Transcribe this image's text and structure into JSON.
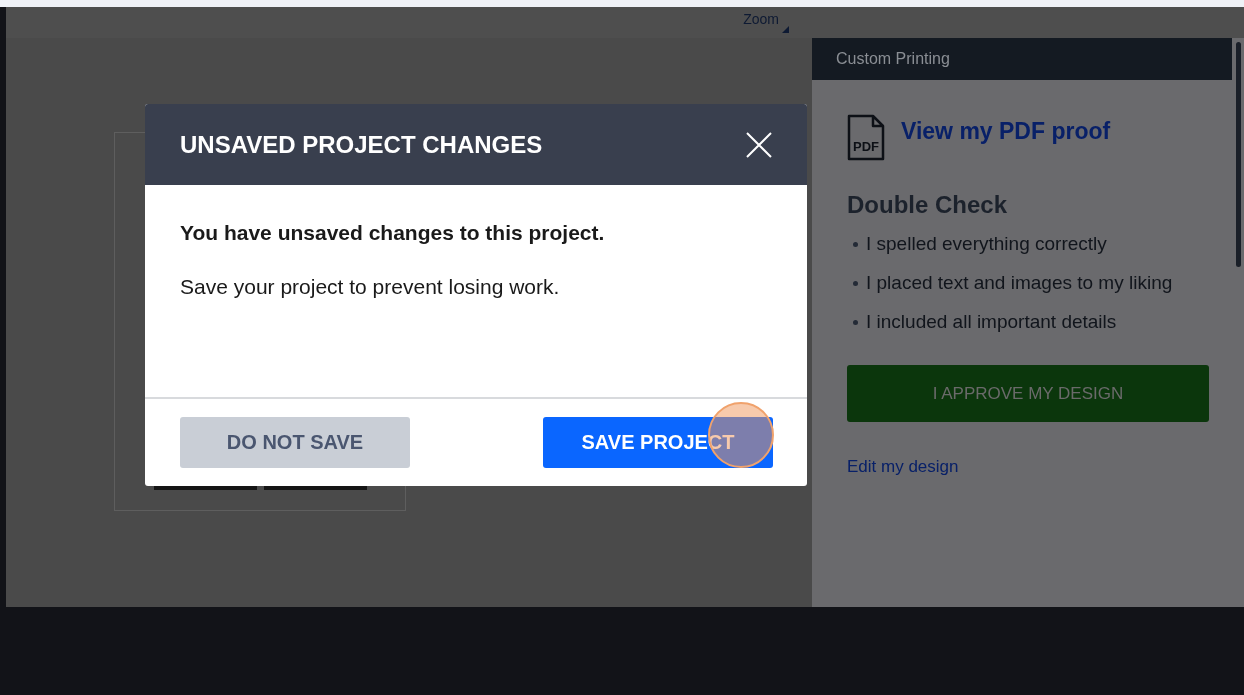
{
  "toolbar": {
    "zoom_label": "Zoom"
  },
  "side_panel": {
    "title": "Custom Printing",
    "proof_icon_text": "PDF",
    "proof_link": "View my PDF proof",
    "checklist_heading": "Double Check",
    "checklist": [
      "I spelled everything correctly",
      "I placed text and images to my liking",
      "I included all important details"
    ],
    "approve_button": "I APPROVE MY DESIGN",
    "edit_link": "Edit my design"
  },
  "dialog": {
    "title": "UNSAVED PROJECT CHANGES",
    "heading": "You have unsaved changes to this project.",
    "message": "Save your project to prevent losing work.",
    "buttons": [
      {
        "label": "DO NOT SAVE",
        "kind": "secondary"
      },
      {
        "label": "SAVE PROJECT",
        "kind": "primary"
      }
    ]
  }
}
